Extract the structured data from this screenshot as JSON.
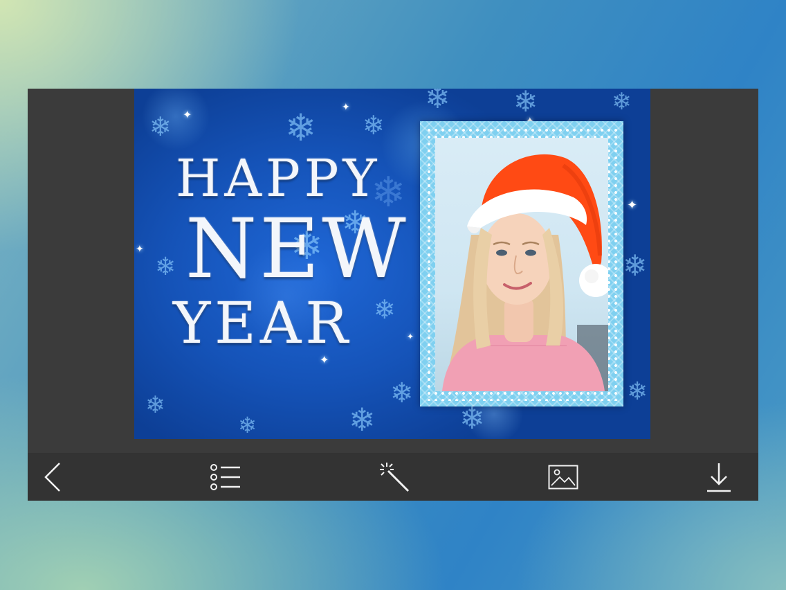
{
  "card": {
    "greeting_line1": "HAPPY",
    "greeting_line2": "NEW",
    "greeting_line3": "YEAR"
  },
  "toolbar": {
    "buttons": [
      {
        "icon": "chevron-left-icon"
      },
      {
        "icon": "list-icon"
      },
      {
        "icon": "magic-wand-icon"
      },
      {
        "icon": "image-icon"
      },
      {
        "icon": "download-icon"
      }
    ]
  },
  "colors": {
    "app_background": "#3b3b3b",
    "toolbar_background": "#333333",
    "card_blue": "#1553b8",
    "frame_cyan": "#7fd0f0",
    "santa_hat_red": "#ff4a14",
    "sweater_pink": "#f1a0b4"
  }
}
